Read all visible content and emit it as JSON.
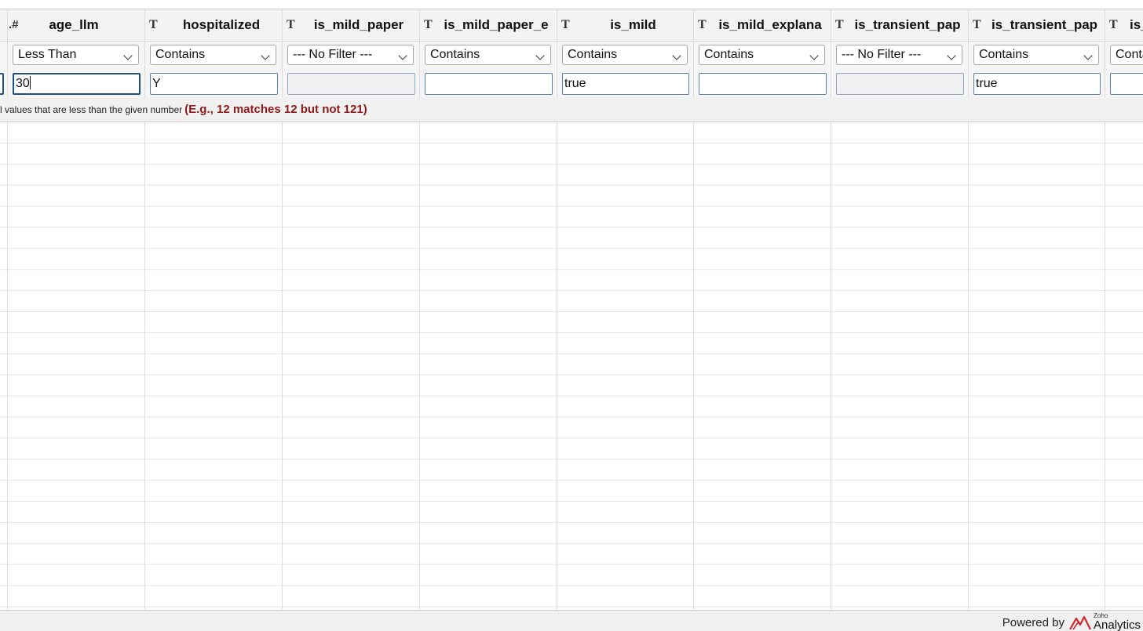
{
  "columns": [
    {
      "type_icon": "#",
      "label": "",
      "filter": "",
      "value": "",
      "input_state": "focused-partial"
    },
    {
      "type_icon": ".#",
      "label": "age_llm",
      "filter": "Less Than",
      "value": "30",
      "input_state": "focused"
    },
    {
      "type_icon": "T",
      "label": "hospitalized",
      "filter": "Contains",
      "value": "Y",
      "input_state": "normal"
    },
    {
      "type_icon": "T",
      "label": "is_mild_paper",
      "filter": "--- No Filter ---",
      "value": "",
      "input_state": "disabled"
    },
    {
      "type_icon": "T",
      "label": "is_mild_paper_e",
      "filter": "Contains",
      "value": "",
      "input_state": "normal"
    },
    {
      "type_icon": "T",
      "label": "is_mild",
      "filter": "Contains",
      "value": "true",
      "input_state": "normal"
    },
    {
      "type_icon": "T",
      "label": "is_mild_explana",
      "filter": "Contains",
      "value": "",
      "input_state": "normal"
    },
    {
      "type_icon": "T",
      "label": "is_transient_pap",
      "filter": "--- No Filter ---",
      "value": "",
      "input_state": "disabled"
    },
    {
      "type_icon": "T",
      "label": "is_transient_pap",
      "filter": "Contains",
      "value": "true",
      "input_state": "normal"
    },
    {
      "type_icon": "T",
      "label": "is_",
      "filter": "Conta",
      "value": "",
      "input_state": "normal"
    }
  ],
  "tip": {
    "text": "l values that are less than the given number",
    "example": "(E.g., 12 matches 12 but not 121)"
  },
  "footer": {
    "powered_by": "Powered by",
    "brand_small": "Zoho",
    "brand_name": "Analytics"
  },
  "colors": {
    "accent_blue": "#1f4f87",
    "tip_red": "#8b1a1a",
    "logo_red": "#d0282e"
  }
}
